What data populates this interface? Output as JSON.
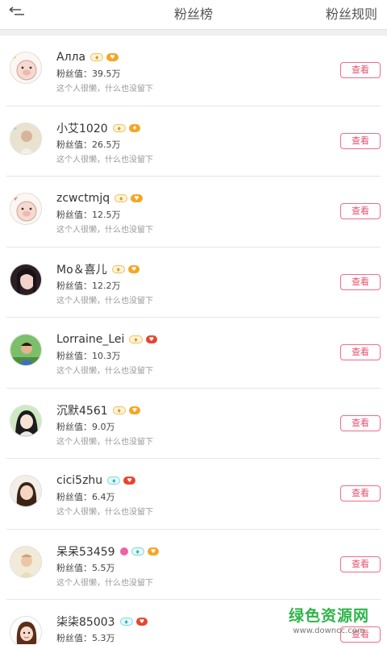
{
  "header": {
    "title": "粉丝榜",
    "rules_label": "粉丝规则",
    "back_icon": "back-arrow-icon"
  },
  "colors": {
    "accent_pink": "#e8506f",
    "divider": "#e6e6e6",
    "watermark_green": "#2fb54a"
  },
  "rows": [
    {
      "name": "Алла",
      "fans": "粉丝值：39.5万",
      "signature": "这个人很懒，什么也没留下",
      "view_label": "查看",
      "avatar_icon": "pig-cartoon-avatar"
    },
    {
      "name": "小艾1020",
      "fans": "粉丝值：26.5万",
      "signature": "这个人很懒，什么也没留下",
      "view_label": "查看",
      "avatar_icon": "girl-photo-avatar"
    },
    {
      "name": "zcwctmjq",
      "fans": "粉丝值：12.5万",
      "signature": "这个人很懒，什么也没留下",
      "view_label": "查看",
      "avatar_icon": "pig-cartoon-avatar"
    },
    {
      "name": "Mo＆喜儿",
      "fans": "粉丝值：12.2万",
      "signature": "这个人很懒，什么也没留下",
      "view_label": "查看",
      "avatar_icon": "woman-photo-avatar"
    },
    {
      "name": "Lorraine_Lei",
      "fans": "粉丝值：10.3万",
      "signature": "这个人很懒，什么也没留下",
      "view_label": "查看",
      "avatar_icon": "boy-photo-avatar"
    },
    {
      "name": "沉默4561",
      "fans": "粉丝值：9.0万",
      "signature": "这个人很懒，什么也没留下",
      "view_label": "查看",
      "avatar_icon": "anime-girl-avatar"
    },
    {
      "name": "cici5zhu",
      "fans": "粉丝值：6.4万",
      "signature": "这个人很懒，什么也没留下",
      "view_label": "查看",
      "avatar_icon": "girl-photo-avatar"
    },
    {
      "name": "呆呆53459",
      "fans": "粉丝值：5.5万",
      "signature": "这个人很懒，什么也没留下",
      "view_label": "查看",
      "avatar_icon": "child-photo-avatar"
    },
    {
      "name": "柒柒85003",
      "fans": "粉丝值：5.3万",
      "signature": "",
      "view_label": "查看",
      "avatar_icon": "cartoon-girl-avatar"
    }
  ],
  "watermark": {
    "main": "绿色资源网",
    "sub": "www.downcc.com"
  }
}
